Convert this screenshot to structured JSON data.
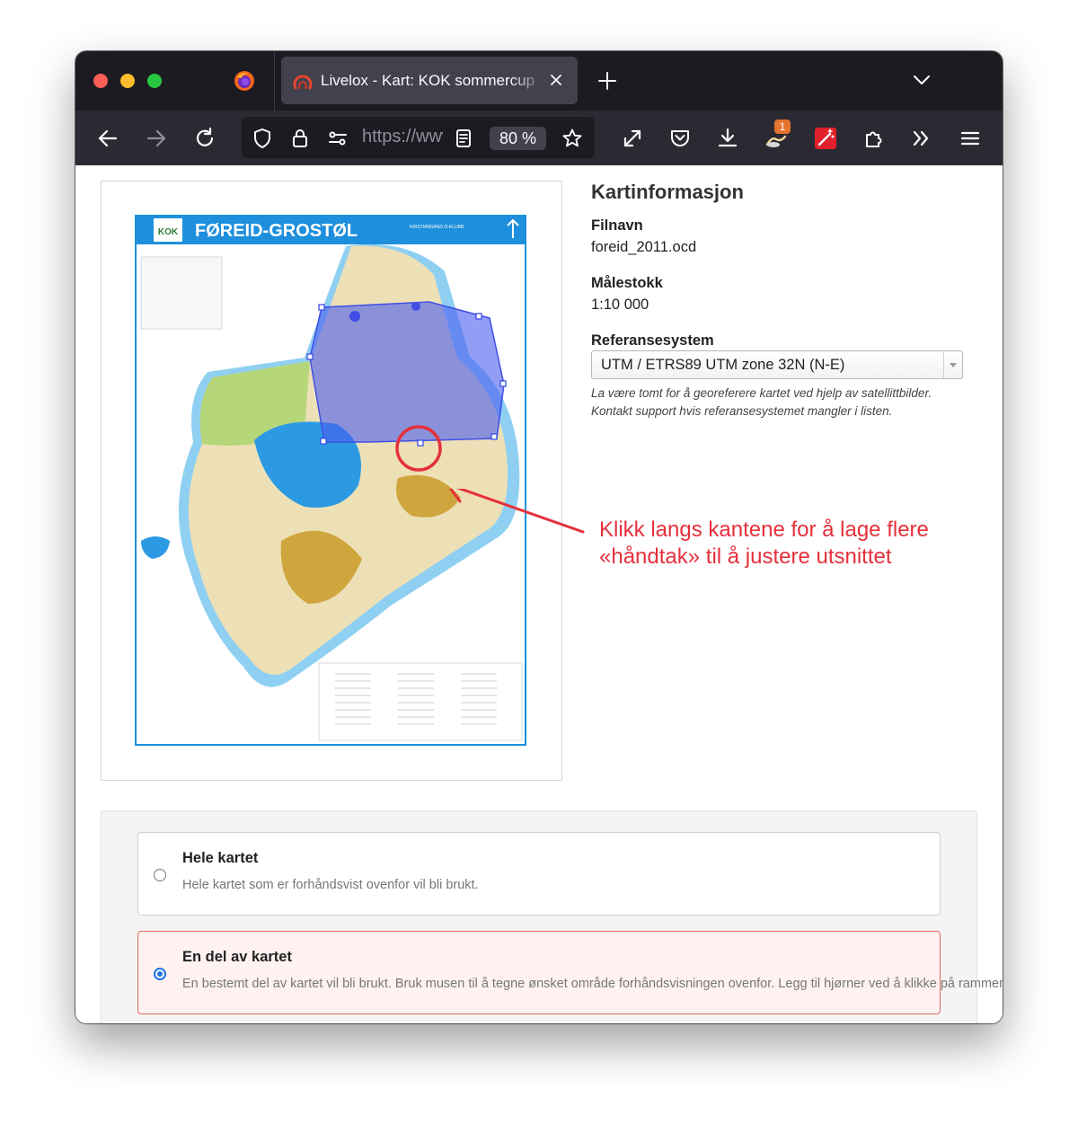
{
  "browser": {
    "tab_title": "Livelox - Kart: KOK sommercup",
    "url_text": "https://www.livelox.com",
    "zoom": "80 %",
    "extension_badge_count": "1",
    "icons": [
      "firefox-logo-icon",
      "livelox-favicon-icon",
      "close-icon",
      "plus-icon",
      "chevron-down-icon",
      "back-arrow-icon",
      "forward-arrow-icon",
      "reload-icon",
      "shield-icon",
      "lock-icon",
      "permissions-icon",
      "reader-view-icon",
      "star-icon",
      "fullscreen-icon",
      "pocket-icon",
      "download-icon",
      "extension-icon",
      "magic-wand-icon",
      "puzzle-icon",
      "overflow-icon",
      "hamburger-menu-icon"
    ]
  },
  "map_preview": {
    "map_title": "FØREID-GROSTØL",
    "club_text": "KRISTIANSAND O-KLUBB",
    "club_logo": "KOK",
    "colors": {
      "water": "#2b9ae3",
      "selection": "#4a5bf0",
      "annotation": "#e5303c"
    }
  },
  "info": {
    "heading": "Kartinformasjon",
    "filename_label": "Filnavn",
    "filename_value": "foreid_2011.ocd",
    "scale_label": "Målestokk",
    "scale_value": "1:10 000",
    "refsys_label": "Referansesystem",
    "refsys_value": "UTM / ETRS89 UTM zone 32N (N-E)",
    "help_line1": "La være tomt for å georeferere kartet ved hjelp av satellittbilder.",
    "help_line2": "Kontakt support hvis referansesystemet mangler i listen."
  },
  "annotation": {
    "line1": "Klikk langs kantene for å lage flere",
    "line2": "«håndtak» til å justere utsnittet"
  },
  "options": [
    {
      "title": "Hele kartet",
      "desc": "Hele kartet som er forhåndsvist ovenfor vil bli brukt.",
      "selected": false
    },
    {
      "title": "En del av kartet",
      "desc": "En bestemt del av kartet vil bli brukt. Bruk musen til å tegne ønsket område forhåndsvisningen ovenfor. Legg til hjørner ved å klikke på rammen. S",
      "selected": true
    }
  ]
}
